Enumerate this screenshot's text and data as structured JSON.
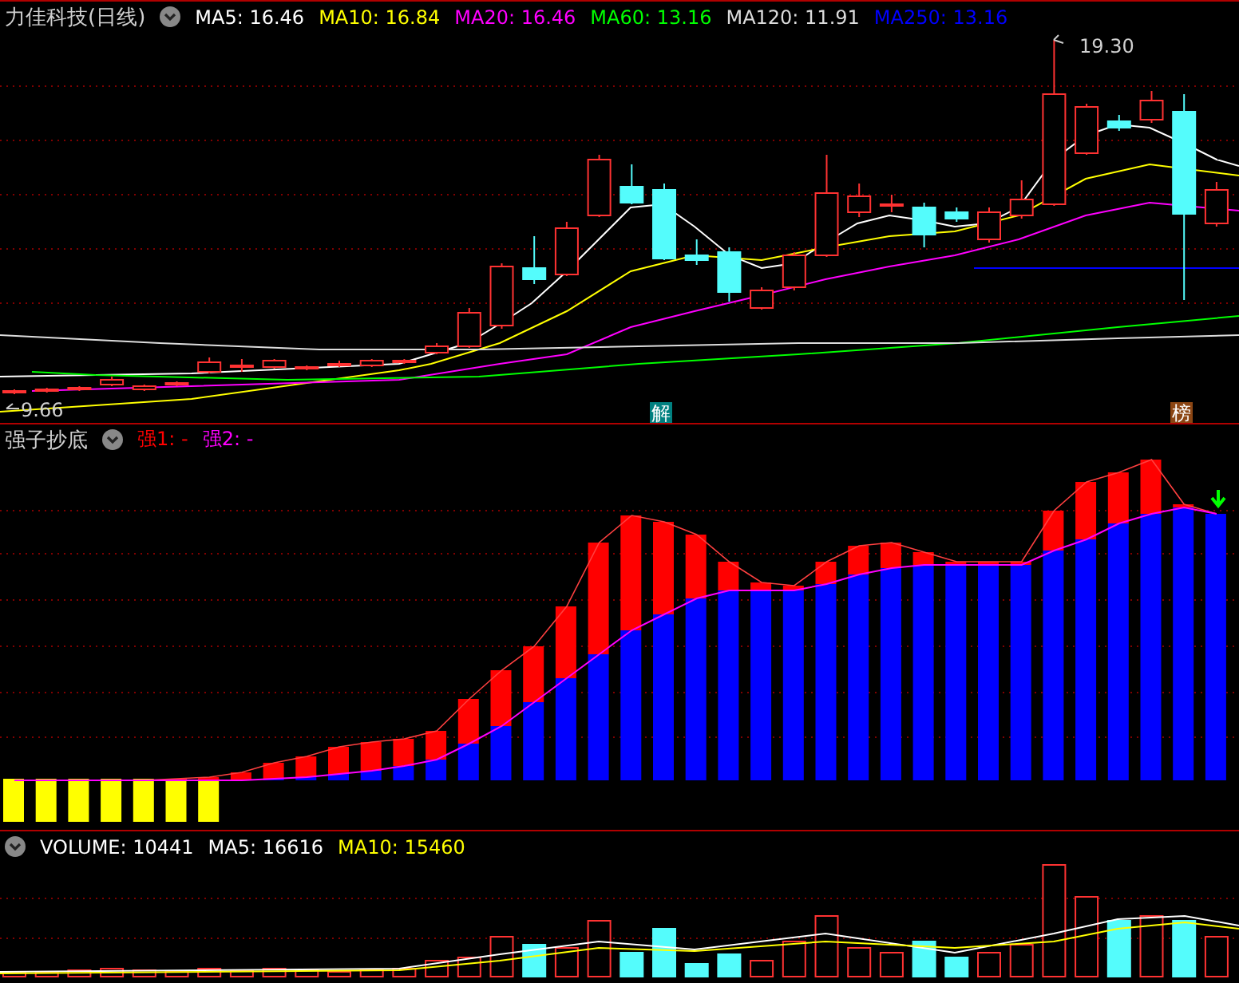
{
  "price_panel": {
    "title": "力佳科技(日线)",
    "indicators": [
      {
        "label": "MA5: 16.46",
        "color": "#ffffff"
      },
      {
        "label": "MA10: 16.84",
        "color": "#ffff00"
      },
      {
        "label": "MA20: 16.46",
        "color": "#ff00ff"
      },
      {
        "label": "MA60: 13.16",
        "color": "#00ff00"
      },
      {
        "label": "MA120: 11.91",
        "color": "#dcdcdc"
      },
      {
        "label": "MA250: 13.16",
        "color": "#0000ff"
      }
    ],
    "high_label": "19.30",
    "low_label": "9.66",
    "event_markers": [
      {
        "text": "解",
        "color": "#008080"
      },
      {
        "text": "榜",
        "color": "#8b4513"
      }
    ]
  },
  "indicator_panel": {
    "title": "强子抄底",
    "indicators": [
      {
        "label": "强1: -",
        "color": "#ff0000"
      },
      {
        "label": "强2: -",
        "color": "#ff00ff"
      }
    ]
  },
  "volume_panel": {
    "indicators": [
      {
        "label": "VOLUME: 10441",
        "color": "#ffffff"
      },
      {
        "label": "MA5: 16616",
        "color": "#ffffff"
      },
      {
        "label": "MA10: 15460",
        "color": "#ffff00"
      }
    ]
  }
}
